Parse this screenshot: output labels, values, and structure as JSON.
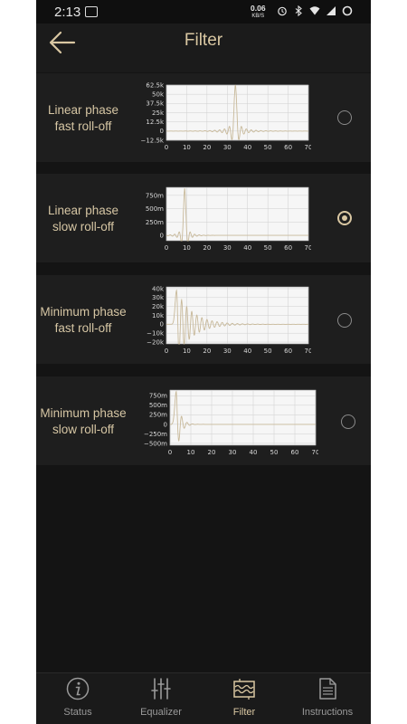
{
  "status": {
    "time": "2:13",
    "data_rate": "0.06",
    "data_rate_unit": "KB/S"
  },
  "header": {
    "title": "Filter"
  },
  "filters": [
    {
      "label": "Linear phase fast roll-off",
      "selected": false,
      "chart_data": {
        "type": "line",
        "y_tick_labels": [
          "62.5k",
          "50k",
          "37.5k",
          "25k",
          "12.5k",
          "0",
          "−12.5k"
        ],
        "y_ticks": [
          62500,
          50000,
          37500,
          25000,
          12500,
          0,
          -12500
        ],
        "x_tick_labels": [
          "0",
          "10",
          "20",
          "30",
          "40",
          "50",
          "60",
          "70"
        ],
        "xlim": [
          0,
          70
        ],
        "ylim": [
          -12500,
          62500
        ],
        "grid": true,
        "shape": "sinc",
        "peak_x": 34,
        "peak_y": 62500,
        "decay": 0.55,
        "period": 2.4,
        "amplitude": 7000
      }
    },
    {
      "label": "Linear phase slow roll-off",
      "selected": true,
      "chart_data": {
        "type": "line",
        "y_tick_labels": [
          "750m",
          "500m",
          "250m",
          "0"
        ],
        "y_ticks": [
          0.75,
          0.5,
          0.25,
          0
        ],
        "x_tick_labels": [
          "0",
          "10",
          "20",
          "30",
          "40",
          "50",
          "60",
          "70"
        ],
        "xlim": [
          0,
          70
        ],
        "ylim": [
          -0.1,
          0.9
        ],
        "grid": true,
        "shape": "sinc",
        "peak_x": 9,
        "peak_y": 0.88,
        "decay": 1.4,
        "period": 2.2,
        "amplitude": 0.12
      }
    },
    {
      "label": "Minimum phase fast roll-off",
      "selected": false,
      "chart_data": {
        "type": "line",
        "y_tick_labels": [
          "40k",
          "30k",
          "20k",
          "10k",
          "0",
          "−10k",
          "−20k"
        ],
        "y_ticks": [
          40000,
          30000,
          20000,
          10000,
          0,
          -10000,
          -20000
        ],
        "x_tick_labels": [
          "0",
          "10",
          "20",
          "30",
          "40",
          "50",
          "60",
          "70"
        ],
        "xlim": [
          0,
          70
        ],
        "ylim": [
          -22000,
          42000
        ],
        "grid": true,
        "shape": "ringing",
        "peak_x": 5,
        "peak_y": 38000,
        "decay": 0.13,
        "period": 2.5,
        "amplitude": 16000
      }
    },
    {
      "label": "Minimum phase slow roll-off",
      "selected": false,
      "chart_data": {
        "type": "line",
        "y_tick_labels": [
          "750m",
          "500m",
          "250m",
          "0",
          "−250m",
          "−500m"
        ],
        "y_ticks": [
          0.75,
          0.5,
          0.25,
          0,
          -0.25,
          -0.5
        ],
        "x_tick_labels": [
          "0",
          "10",
          "20",
          "30",
          "40",
          "50",
          "60",
          "70"
        ],
        "xlim": [
          0,
          70
        ],
        "ylim": [
          -0.55,
          0.9
        ],
        "grid": true,
        "shape": "ringing",
        "peak_x": 3,
        "peak_y": 0.86,
        "decay": 0.55,
        "period": 2.6,
        "amplitude": 0.45
      }
    }
  ],
  "nav": [
    {
      "label": "Status",
      "icon": "info-icon",
      "active": false
    },
    {
      "label": "Equalizer",
      "icon": "equalizer-icon",
      "active": false
    },
    {
      "label": "Filter",
      "icon": "filter-icon",
      "active": true
    },
    {
      "label": "Instructions",
      "icon": "document-icon",
      "active": false
    }
  ],
  "colors": {
    "background": "#141414",
    "card": "#1e1e1e",
    "accent": "#d9c7a2",
    "chart_line": "#c8b99a",
    "chart_bg": "#f6f6f6"
  }
}
